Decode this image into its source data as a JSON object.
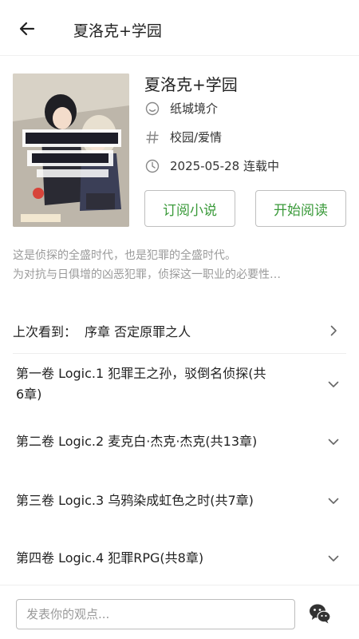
{
  "header": {
    "title": "夏洛克+学园",
    "back_icon": "arrow-left-icon"
  },
  "book": {
    "title": "夏洛克+学园",
    "author": "纸城境介",
    "tags": "校园/爱情",
    "date_status": "2025-05-28 连载中"
  },
  "actions": {
    "subscribe": "订阅小说",
    "read": "开始阅读"
  },
  "description": {
    "line1": "这是侦探的全盛时代，也是犯罪的全盛时代。",
    "line2": "为对抗与日俱增的凶恶犯罪，侦探这一职业的必要性…"
  },
  "last_read": {
    "label": "上次看到：",
    "chapter": "序章 否定原罪之人"
  },
  "volumes": [
    {
      "line1": "第一卷 Logic.1 犯罪王之孙，驳倒名侦探(共",
      "line2": "6章)"
    },
    {
      "line1": "第二卷 Logic.2 麦克白·杰克·杰克(共13章)"
    },
    {
      "line1": "第三卷 Logic.3 乌鸦染成虹色之时(共7章)"
    },
    {
      "line1": "第四卷 Logic.4 犯罪RPG(共8章)"
    }
  ],
  "comment": {
    "placeholder": "发表你的观点..."
  },
  "colors": {
    "accent": "#3a9a3a",
    "muted": "#9a9a9a"
  }
}
